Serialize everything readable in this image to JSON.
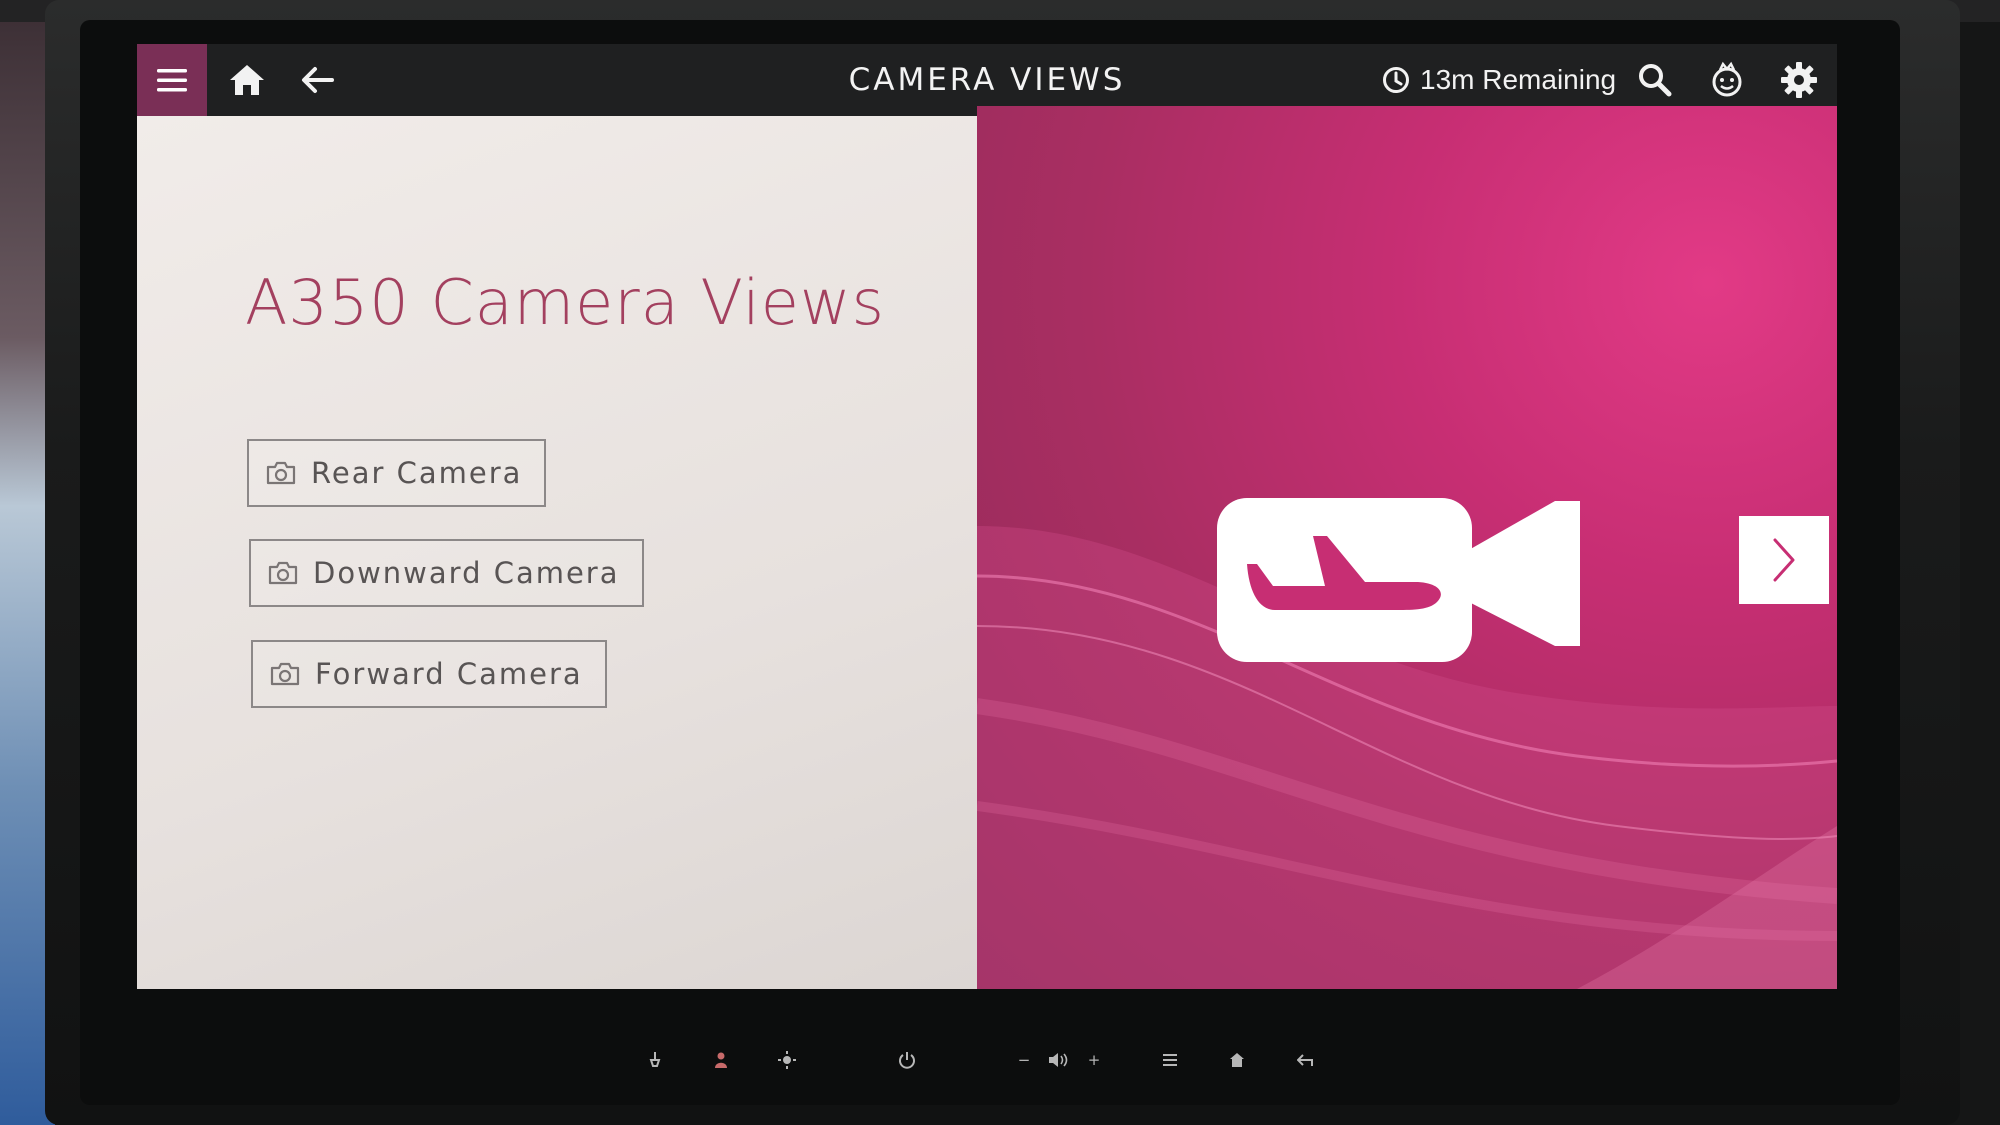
{
  "topbar": {
    "title": "CAMERA VIEWS",
    "remaining_text": "13m Remaining",
    "accent_color": "#7a2f56",
    "icons": [
      "menu-icon",
      "home-icon",
      "back-arrow-icon",
      "clock-icon",
      "search-icon",
      "kids-icon",
      "settings-gear-icon"
    ]
  },
  "main": {
    "title": "A350 Camera Views",
    "title_color": "#a3405f",
    "buttons": [
      {
        "label": "Rear Camera",
        "icon": "camera-icon"
      },
      {
        "label": "Downward Camera",
        "icon": "camera-icon"
      },
      {
        "label": "Forward Camera",
        "icon": "camera-icon"
      }
    ]
  },
  "hero": {
    "icon": "airplane-video-camera-icon",
    "background_color": "#c72e73",
    "next_icon": "chevron-right-icon"
  },
  "hardware_controls": {
    "buttons": [
      {
        "icon": "reading-light-icon"
      },
      {
        "icon": "call-attendant-icon"
      },
      {
        "icon": "brightness-icon"
      },
      {
        "icon": "power-icon"
      },
      {
        "label": "−"
      },
      {
        "icon": "volume-icon"
      },
      {
        "label": "+"
      },
      {
        "icon": "list-icon"
      },
      {
        "icon": "home-icon"
      },
      {
        "icon": "back-icon"
      }
    ]
  }
}
